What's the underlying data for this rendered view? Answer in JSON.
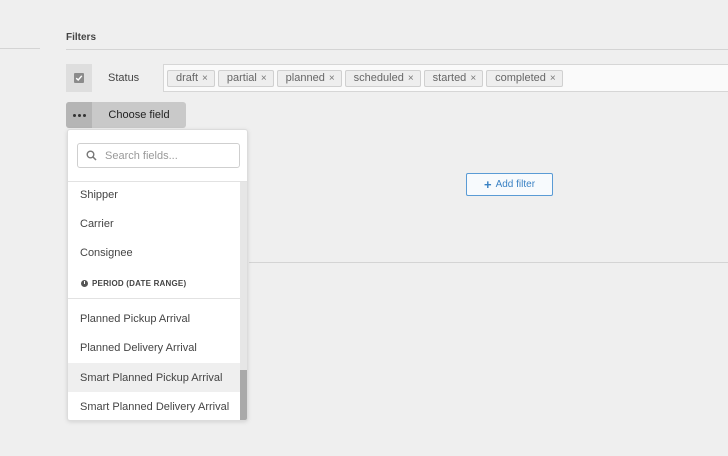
{
  "filters": {
    "title": "Filters"
  },
  "status_filter": {
    "label": "Status",
    "chips": [
      "draft",
      "partial",
      "planned",
      "scheduled",
      "started",
      "completed"
    ],
    "remove_glyph": "×"
  },
  "choose_field": {
    "label": "Choose field"
  },
  "add_filter": {
    "label": "Add filter",
    "plus": "+"
  },
  "dropdown": {
    "search": {
      "placeholder": "Search fields...",
      "value": ""
    },
    "items_top": [
      "Shipper",
      "Carrier",
      "Consignee"
    ],
    "group": {
      "label": "PERIOD (DATE RANGE)",
      "icon": "clock-icon"
    },
    "items_bottom": [
      "Planned Pickup Arrival",
      "Planned Delivery Arrival",
      "Smart Planned Pickup Arrival",
      "Smart Planned Delivery Arrival"
    ],
    "hovered_item": "Smart Planned Pickup Arrival"
  },
  "colors": {
    "background": "#efefef",
    "accent": "#3b82c4",
    "chip_bg": "#eeeeee"
  }
}
